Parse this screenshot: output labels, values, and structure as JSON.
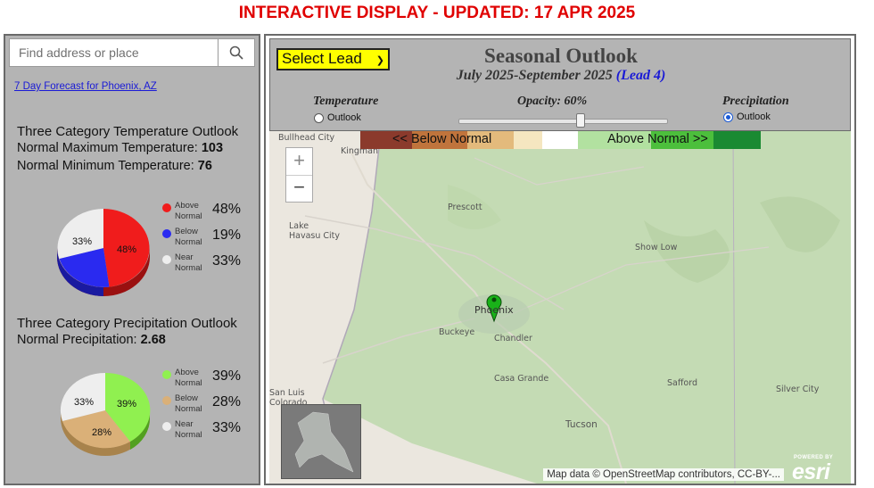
{
  "banner": "INTERACTIVE DISPLAY - UPDATED: 17 APR 2025",
  "search": {
    "placeholder": "Find address or place"
  },
  "forecast_link": "7 Day Forecast for Phoenix, AZ",
  "temperature": {
    "title": "Three Category Temperature Outlook",
    "max_label": "Normal Maximum Temperature: ",
    "max_value": "103",
    "min_label": "Normal Minimum Temperature: ",
    "min_value": "76",
    "pie_labels": {
      "above": "48%",
      "below": "",
      "near": "33%"
    },
    "legend": [
      {
        "label": "Above Normal",
        "pct": "48%",
        "color": "#f01c1c"
      },
      {
        "label": "Below Normal",
        "pct": "19%",
        "color": "#2a2af0"
      },
      {
        "label": "Near Normal",
        "pct": "33%",
        "color": "#eeeeee"
      }
    ]
  },
  "precipitation": {
    "title": "Three Category Precipitation Outlook",
    "normal_label": "Normal Precipitation: ",
    "normal_value": "2.68",
    "pie_labels": {
      "above": "39%",
      "below": "28%",
      "near": "33%"
    },
    "legend": [
      {
        "label": "Above Normal",
        "pct": "39%",
        "color": "#90f050"
      },
      {
        "label": "Below Normal",
        "pct": "28%",
        "color": "#dab078"
      },
      {
        "label": "Near Normal",
        "pct": "33%",
        "color": "#eeeeee"
      }
    ]
  },
  "controls": {
    "lead_button": "Select Lead",
    "title": "Seasonal Outlook",
    "subtitle": "July 2025-September 2025",
    "lead_text": "(Lead 4)",
    "temperature_label": "Temperature",
    "temperature_radio": "Outlook",
    "opacity_label": "Opacity: 60%",
    "opacity_value": 60,
    "precipitation_label": "Precipitation",
    "precipitation_radio": "Outlook"
  },
  "map": {
    "legend_below": "<<   Below Normal",
    "legend_above": "Above Normal   >>",
    "zoom_in": "+",
    "zoom_out": "−",
    "places": [
      "Bullhead City",
      "Kingman",
      "Prescott",
      "Lake Havasu City",
      "Show Low",
      "Phoenix",
      "Buckeye",
      "Chandler",
      "Casa Grande",
      "Safford",
      "Silver City",
      "San Luis Colorado",
      "Tucson"
    ],
    "attribution": "Map data © OpenStreetMap contributors, CC-BY-...",
    "esri_small": "POWERED BY",
    "esri_big": "esri"
  }
}
